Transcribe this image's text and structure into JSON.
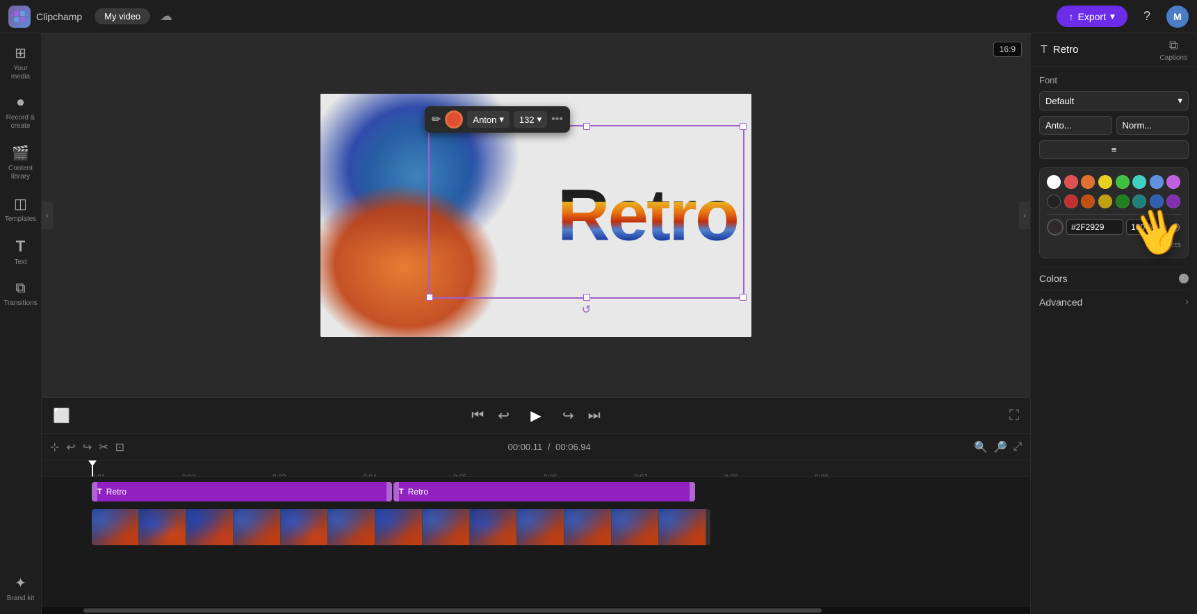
{
  "topbar": {
    "logo_text": "Clipchamp",
    "tab_label": "My video",
    "export_label": "Export",
    "help_char": "?",
    "avatar_label": "M"
  },
  "sidebar": {
    "items": [
      {
        "id": "your-media",
        "icon": "⬜",
        "label": "Your media"
      },
      {
        "id": "record-create",
        "icon": "⏺",
        "label": "Record &\ncreate"
      },
      {
        "id": "content-library",
        "icon": "🎬",
        "label": "Content\nlibrary"
      },
      {
        "id": "templates",
        "icon": "⊞",
        "label": "Templates"
      },
      {
        "id": "text",
        "icon": "T",
        "label": "Text"
      },
      {
        "id": "transitions",
        "icon": "◧",
        "label": "Transitions"
      },
      {
        "id": "brand-kit",
        "icon": "✦",
        "label": "Brand kit"
      }
    ]
  },
  "canvas": {
    "aspect_ratio": "16:9",
    "retro_text": "Retro"
  },
  "toolbar": {
    "font_name": "Anton",
    "font_size": "132",
    "more_icon": "•••"
  },
  "transport": {
    "time_current": "00:00.11",
    "time_total": "00:06.94",
    "time_separator": "/"
  },
  "timeline": {
    "timestamps": [
      "0:01",
      "0:02",
      "0:03",
      "0:04",
      "0:05",
      "0:06",
      "0:07",
      "0:08",
      "0:09"
    ],
    "text_clip1_label": "Retro",
    "text_clip2_label": "Retro"
  },
  "panel": {
    "title": "Retro",
    "captions_label": "Captions",
    "font_section_label": "Font",
    "font_style_value": "Default",
    "font_name_value": "Anto...",
    "font_weight_value": "Norm...",
    "align_icon": "≡",
    "colors_label": "Colors",
    "advanced_label": "Advanced"
  },
  "color_picker": {
    "row1": [
      {
        "color": "#ffffff",
        "label": "white"
      },
      {
        "color": "#e05050",
        "label": "red"
      },
      {
        "color": "#e07030",
        "label": "orange"
      },
      {
        "color": "#e8d020",
        "label": "yellow"
      },
      {
        "color": "#40c040",
        "label": "green"
      },
      {
        "color": "#40d0c0",
        "label": "teal"
      },
      {
        "color": "#6090e0",
        "label": "blue"
      },
      {
        "color": "#c060e0",
        "label": "purple"
      }
    ],
    "row2": [
      {
        "color": "#222222",
        "label": "black"
      },
      {
        "color": "#c03030",
        "label": "dark-red"
      },
      {
        "color": "#c05010",
        "label": "dark-orange"
      },
      {
        "color": "#c0a010",
        "label": "dark-yellow"
      },
      {
        "color": "#208020",
        "label": "dark-green"
      },
      {
        "color": "#208078",
        "label": "dark-teal"
      },
      {
        "color": "#3060b0",
        "label": "dark-blue"
      },
      {
        "color": "#8030b0",
        "label": "dark-purple"
      }
    ],
    "hex_value": "#2F2929",
    "opacity_value": "100%",
    "effects_label": "Effects"
  }
}
